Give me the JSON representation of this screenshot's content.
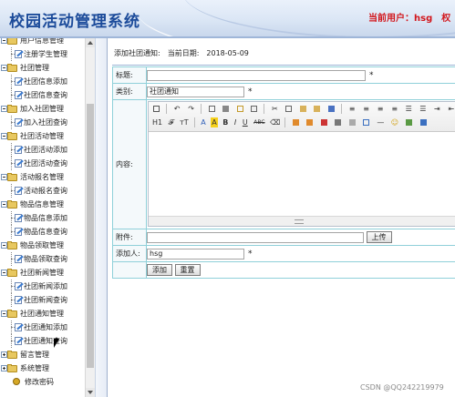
{
  "header": {
    "title": "校园活动管理系统",
    "current_user_label": "当前用户：hsg",
    "current_user_extra": "权"
  },
  "sidebar": {
    "groups": [
      {
        "label": "用户信息管理",
        "expanded": true,
        "items": [
          "注册学生管理"
        ]
      },
      {
        "label": "社团管理",
        "expanded": true,
        "items": [
          "社团信息添加",
          "社团信息查询"
        ]
      },
      {
        "label": "加入社团管理",
        "expanded": true,
        "items": [
          "加入社团查询"
        ]
      },
      {
        "label": "社团活动管理",
        "expanded": true,
        "items": [
          "社团活动添加",
          "社团活动查询"
        ]
      },
      {
        "label": "活动报名管理",
        "expanded": true,
        "items": [
          "活动报名查询"
        ]
      },
      {
        "label": "物品信息管理",
        "expanded": true,
        "items": [
          "物品信息添加",
          "物品信息查询"
        ]
      },
      {
        "label": "物品领取管理",
        "expanded": true,
        "items": [
          "物品领取查询"
        ]
      },
      {
        "label": "社团新闻管理",
        "expanded": true,
        "items": [
          "社团新闻添加",
          "社团新闻查询"
        ]
      },
      {
        "label": "社团通知管理",
        "expanded": true,
        "items": [
          "社团通知添加",
          "社团通知查询"
        ]
      },
      {
        "label": "留言管理",
        "expanded": false,
        "items": []
      },
      {
        "label": "系统管理",
        "expanded": false,
        "items": []
      }
    ],
    "change_password": "修改密码"
  },
  "main": {
    "page_title": "添加社团通知:",
    "date_label": "当前日期:",
    "date_value": "2018-05-09",
    "form": {
      "title_label": "标题:",
      "title_value": "",
      "category_label": "类别:",
      "category_value": "社团通知",
      "content_label": "内容:",
      "attachment_label": "附件:",
      "attachment_value": "",
      "upload_button": "上传",
      "adder_label": "添加人:",
      "adder_value": "hsg",
      "required_mark": "*",
      "submit_button": "添加",
      "reset_button": "重置"
    },
    "editor_toolbar": {
      "row1": [
        "html-icon",
        "undo-icon",
        "redo-icon",
        "preview-icon",
        "print-icon",
        "template-icon",
        "code-icon",
        "cut-icon",
        "copy-icon",
        "paste-icon",
        "paste-text-icon",
        "paste-word-icon",
        "align-left-icon",
        "align-center-icon",
        "align-right-icon",
        "align-justify-icon",
        "ordered-list-icon",
        "unordered-list-icon",
        "indent-icon",
        "outdent-icon",
        "subscript-icon",
        "superscript-icon"
      ],
      "row2_text": {
        "heading": "H1",
        "font_family": "𝓕",
        "font_size": "тT",
        "font_color": "A",
        "highlight": "A",
        "bold": "B",
        "italic": "I",
        "underline": "U",
        "strike": "ABC"
      },
      "row2_icons": [
        "remove-format-icon",
        "image-icon",
        "multi-image-icon",
        "flash-icon",
        "media-icon",
        "table-icon",
        "hr-icon",
        "emoticon-icon",
        "pagebreak-icon",
        "link-icon",
        "unlink-icon"
      ]
    }
  },
  "watermark": "CSDN @QQ242219979"
}
